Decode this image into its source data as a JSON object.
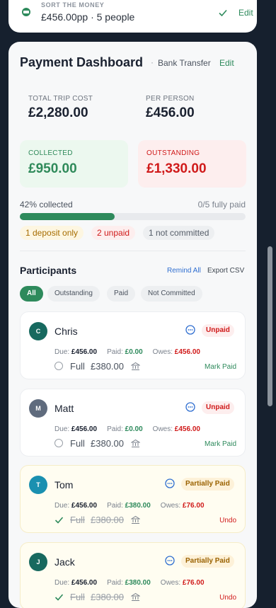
{
  "top": {
    "label": "SORT THE MONEY",
    "value": "£456.00pp · 5 people",
    "edit": "Edit"
  },
  "dashboard": {
    "title": "Payment Dashboard",
    "separator": "·",
    "method": "Bank Transfer",
    "edit": "Edit",
    "total_label": "TOTAL TRIP COST",
    "total": "£2,280.00",
    "per_person_label": "PER PERSON",
    "per_person": "£456.00",
    "collected_label": "COLLECTED",
    "collected": "£950.00",
    "outstanding_label": "OUTSTANDING",
    "outstanding": "£1,330.00",
    "progress_text": "42% collected",
    "progress": 0.42,
    "paid_text": "0/5 fully paid",
    "pills": {
      "deposit": "1 deposit only",
      "unpaid": "2 unpaid",
      "not_committed": "1 not committed"
    }
  },
  "participants": {
    "title": "Participants",
    "remind": "Remind All",
    "export": "Export CSV",
    "tabs": [
      "All",
      "Outstanding",
      "Paid",
      "Not Committed"
    ],
    "labels": {
      "due": "Due:",
      "paid": "Paid:",
      "owes": "Owes:",
      "full": "Full"
    },
    "list": [
      {
        "initial": "C",
        "name": "Chris",
        "status": "Unpaid",
        "due": "£456.00",
        "paid": "£0.00",
        "owes": "£456.00",
        "full_amount": "£380.00",
        "action": "Mark Paid",
        "color": "#17695f"
      },
      {
        "initial": "M",
        "name": "Matt",
        "status": "Unpaid",
        "due": "£456.00",
        "paid": "£0.00",
        "owes": "£456.00",
        "full_amount": "£380.00",
        "action": "Mark Paid",
        "color": "#5f6b7d"
      },
      {
        "initial": "T",
        "name": "Tom",
        "status": "Partially Paid",
        "due": "£456.00",
        "paid": "£380.00",
        "owes": "£76.00",
        "full_amount": "£380.00",
        "action": "Undo",
        "color": "#1a90b0"
      },
      {
        "initial": "J",
        "name": "Jack",
        "status": "Partially Paid",
        "due": "£456.00",
        "paid": "£380.00",
        "owes": "£76.00",
        "full_amount": "£380.00",
        "action": "Undo",
        "color": "#17695f"
      }
    ]
  },
  "colors": {
    "accent": "#2e8a5c",
    "danger": "#d01a1a",
    "warning": "#a66c00",
    "link": "#2f6ed0"
  }
}
